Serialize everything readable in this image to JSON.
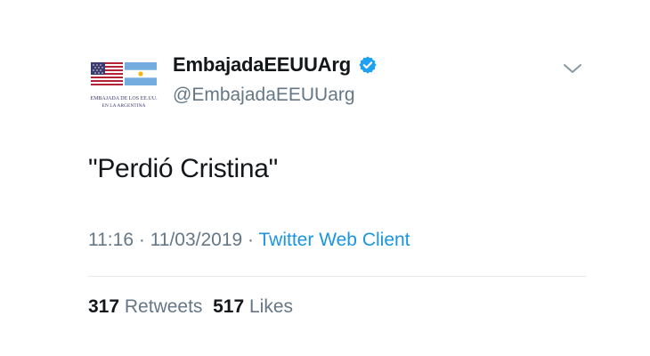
{
  "author": {
    "display_name": "EmbajadaEEUUArg",
    "handle": "@EmbajadaEEUUarg",
    "verified": true,
    "avatar_caption_line1": "Embajada de los EE.UU.",
    "avatar_caption_line2": "en la Argentina"
  },
  "tweet": {
    "text": "\"Perdió Cristina\""
  },
  "meta": {
    "time": "11:16",
    "separator1": " · ",
    "date": "11/03/2019",
    "separator2": " · ",
    "source": "Twitter Web Client"
  },
  "stats": {
    "retweets_count": "317",
    "retweets_label": "Retweets",
    "likes_count": "517",
    "likes_label": "Likes"
  },
  "colors": {
    "text_primary": "#14171a",
    "text_secondary": "#657786",
    "link": "#1b95e0",
    "verified": "#1da1f2",
    "divider": "#e6ecf0"
  },
  "icons": {
    "verified": "verified-badge-icon",
    "menu": "chevron-down-icon"
  }
}
